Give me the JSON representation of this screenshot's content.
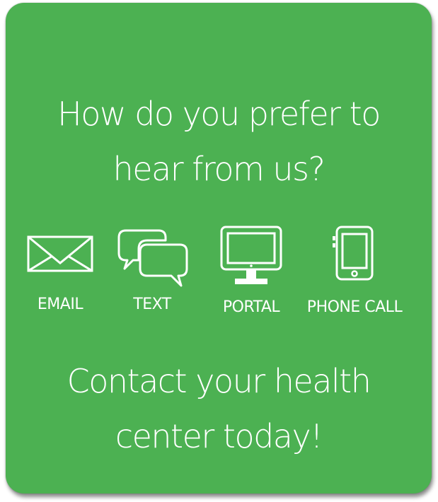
{
  "card": {
    "question_line1": "How do you prefer to",
    "question_line2": "hear from us?",
    "cta_line1": "Contact your health",
    "cta_line2": "center today!"
  },
  "options": [
    {
      "label": "EMAIL",
      "icon": "envelope-icon"
    },
    {
      "label": "TEXT",
      "icon": "chat-bubbles-icon"
    },
    {
      "label": "PORTAL",
      "icon": "monitor-icon"
    },
    {
      "label": "PHONE CALL",
      "icon": "smartphone-icon"
    }
  ],
  "colors": {
    "card_background": "#4cb152",
    "text": "#ffffff"
  }
}
